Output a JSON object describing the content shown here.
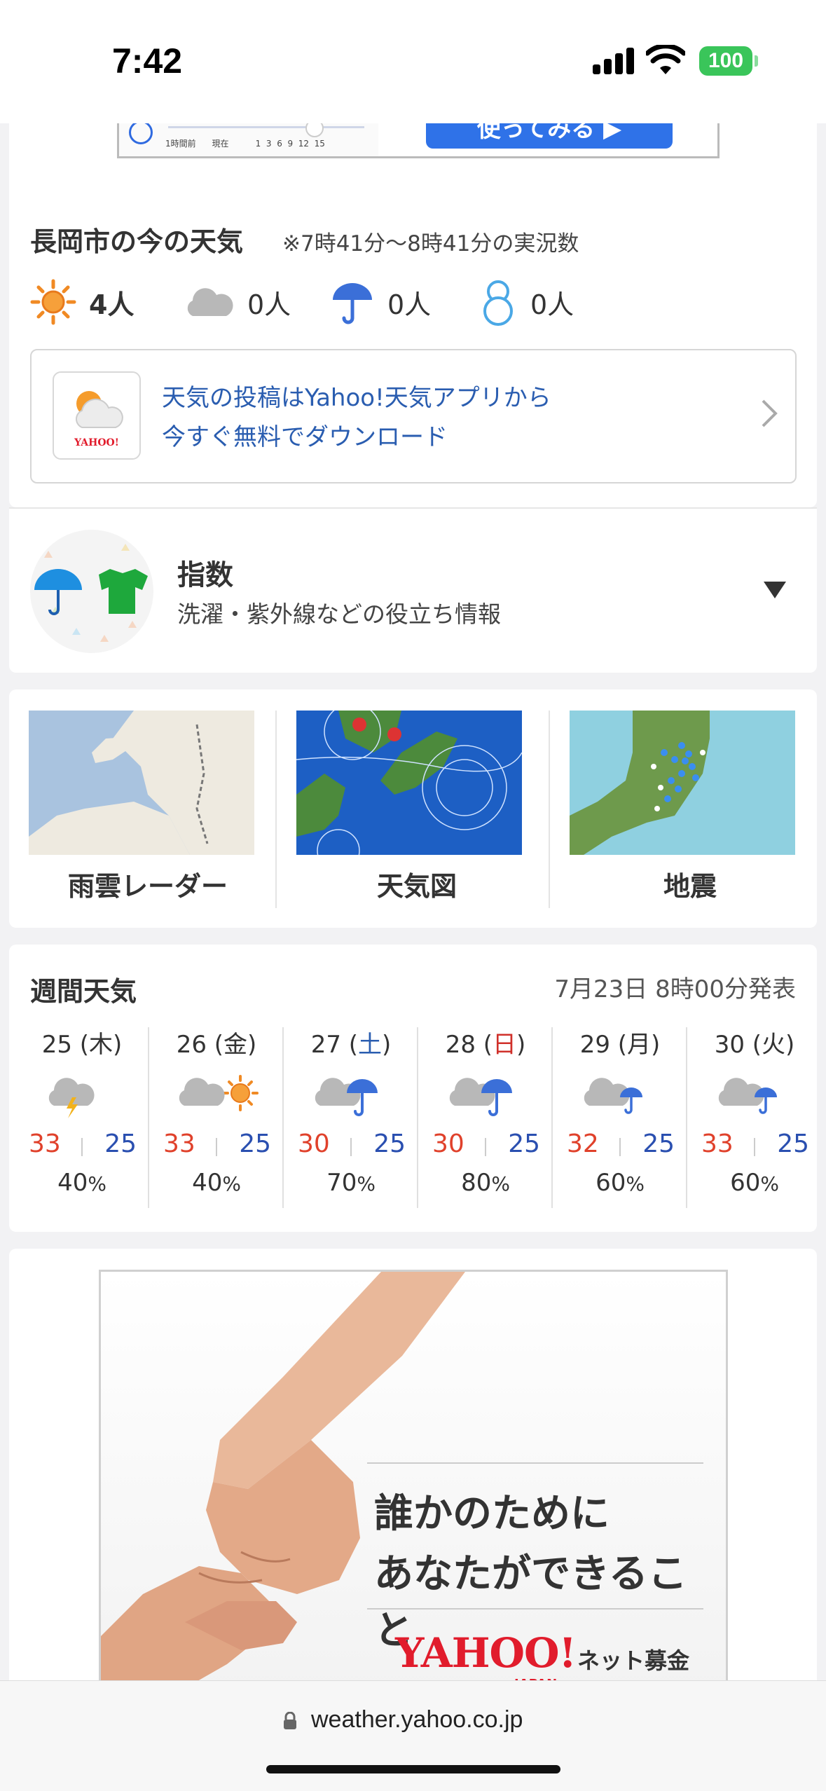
{
  "status_bar": {
    "time": "7:42",
    "battery": "100"
  },
  "top_ad": {
    "ticks_label": "1時間前      現在          1  3  6  9  12  15",
    "button": "使ってみる ▶"
  },
  "now_weather": {
    "title": "長岡市の今の天気",
    "subtitle": "※7時41分〜8時41分の実況数",
    "counts": [
      {
        "icon": "sun-icon",
        "value": "4人"
      },
      {
        "icon": "cloud-icon",
        "value": "0人"
      },
      {
        "icon": "umbrella-icon",
        "value": "0人"
      },
      {
        "icon": "snowman-icon",
        "value": "0人"
      }
    ],
    "promo": {
      "line1": "天気の投稿はYahoo!天気アプリから",
      "line2": "今すぐ無料でダウンロード",
      "logo": "YAHOO!"
    }
  },
  "index": {
    "title": "指数",
    "subtitle": "洗濯・紫外線などの役立ち情報"
  },
  "maps": [
    {
      "label": "雨雲レーダー"
    },
    {
      "label": "天気図"
    },
    {
      "label": "地震"
    }
  ],
  "weekly": {
    "title": "週間天気",
    "published": "7月23日 8時00分発表",
    "days": [
      {
        "date": "25 (",
        "dow": "木",
        "close": ")",
        "dow_color": "#333333",
        "icon": "thunder-cloud-icon",
        "high": "33",
        "low": "25",
        "pop": "40"
      },
      {
        "date": "26 (",
        "dow": "金",
        "close": ")",
        "dow_color": "#333333",
        "icon": "cloud-sun-icon",
        "high": "33",
        "low": "25",
        "pop": "40"
      },
      {
        "date": "27 (",
        "dow": "土",
        "close": ")",
        "dow_color": "#2a5db0",
        "icon": "cloud-umbrella-icon",
        "high": "30",
        "low": "25",
        "pop": "70"
      },
      {
        "date": "28 (",
        "dow": "日",
        "close": ")",
        "dow_color": "#d0302a",
        "icon": "cloud-umbrella-icon",
        "high": "30",
        "low": "25",
        "pop": "80"
      },
      {
        "date": "29 (",
        "dow": "月",
        "close": ")",
        "dow_color": "#333333",
        "icon": "cloud-umbrella-small-icon",
        "high": "32",
        "low": "25",
        "pop": "60"
      },
      {
        "date": "30 (",
        "dow": "火",
        "close": ")",
        "dow_color": "#333333",
        "icon": "cloud-umbrella-small-icon",
        "high": "33",
        "low": "25",
        "pop": "60"
      }
    ],
    "pop_unit": "%"
  },
  "banner_ad": {
    "line1": "誰かのために",
    "line2": "あなたができること",
    "logo": "YAHOO!",
    "logo_sub": "JAPAN",
    "service": "ネット募金"
  },
  "url_bar": {
    "url": "weather.yahoo.co.jp"
  }
}
